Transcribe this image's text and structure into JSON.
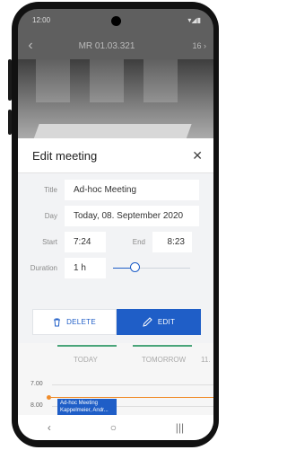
{
  "status_bar": {
    "time": "12:00",
    "icons": "▾◢▮"
  },
  "top_bar": {
    "back_icon": "chevron-left-icon",
    "room_title": "MR 01.03.321",
    "seat_label": "16 ›"
  },
  "dialog": {
    "title": "Edit meeting",
    "close_icon": "close-icon",
    "fields": {
      "title_label": "Title",
      "title_value": "Ad-hoc Meeting",
      "day_label": "Day",
      "day_value": "Today, 08. September 2020",
      "start_label": "Start",
      "start_value": "7:24",
      "end_label": "End",
      "end_value": "8:23",
      "duration_label": "Duration",
      "duration_value": "1 h"
    },
    "duration_slider_level": 0.25,
    "buttons": {
      "delete_label": "DELETE",
      "edit_label": "EDIT"
    }
  },
  "calendar": {
    "tabs": [
      "TODAY",
      "TOMORROW",
      "11."
    ],
    "hours": [
      "7.00",
      "8.00"
    ],
    "event": {
      "title": "Ad-hoc Meeting",
      "attendees": "Kappelmeier, Andr..."
    }
  },
  "nav_bar": {
    "back": "‹",
    "home": "○",
    "recents": "|||"
  },
  "colors": {
    "primary": "#1f5ec7",
    "accent_green": "#4aa57a",
    "now_indicator": "#f08c2a"
  }
}
